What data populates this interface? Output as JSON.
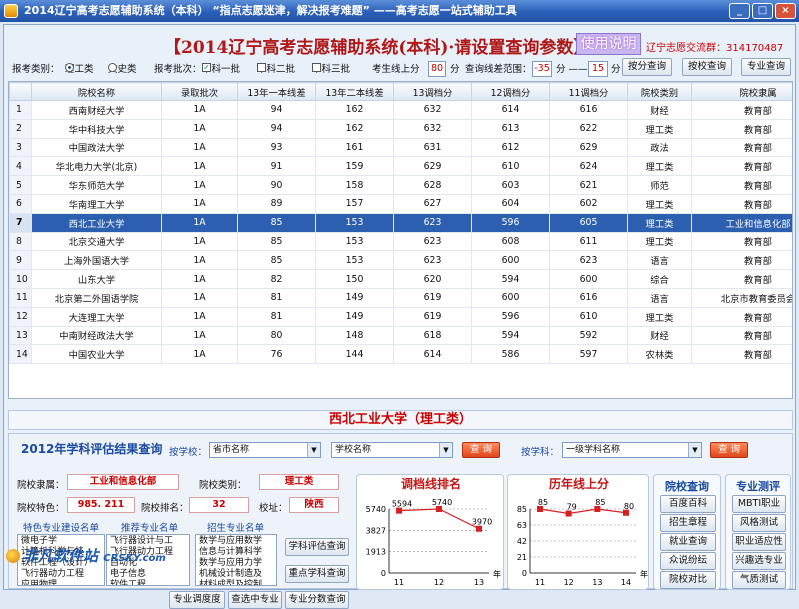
{
  "window": {
    "title": "2014辽宁高考志愿辅助系统（本科） “指点志愿迷津，解决报考难题” ——高考志愿一站式辅助工具",
    "min": "_",
    "max": "□",
    "close": "×"
  },
  "header": {
    "title": "【2014辽宁高考志愿辅助系统(本科)·请设置查询参数】",
    "help": "使用说明",
    "group": "辽宁志愿交流群：314170487"
  },
  "params": {
    "category_label": "报考类别：",
    "category_options": [
      "理工类",
      "文史类"
    ],
    "batch_label": "报考批次：",
    "batch_options": [
      "本科一批",
      "本科二批",
      "本科三批"
    ],
    "score_up_label": "考生线上分",
    "score_up_value": "80",
    "score_unit": "分",
    "range_label": "查询线差范围：",
    "range_min": "-35",
    "range_sep": "分 ——",
    "range_max": "15",
    "range_unit": "分",
    "btn_score": "按分查询",
    "btn_school": "按校查询",
    "btn_major": "专业查询"
  },
  "grid": {
    "columns": [
      "",
      "院校名称",
      "录取批次",
      "13年一本线差",
      "13年二本线差",
      "13调档分",
      "12调档分",
      "11调档分",
      "院校类别",
      "院校隶属"
    ],
    "rows": [
      [
        "1",
        "西南财经大学",
        "1A",
        "94",
        "162",
        "632",
        "614",
        "616",
        "财经",
        "教育部"
      ],
      [
        "2",
        "华中科技大学",
        "1A",
        "94",
        "162",
        "632",
        "613",
        "622",
        "理工类",
        "教育部"
      ],
      [
        "3",
        "中国政法大学",
        "1A",
        "93",
        "161",
        "631",
        "612",
        "629",
        "政法",
        "教育部"
      ],
      [
        "4",
        "华北电力大学(北京)",
        "1A",
        "91",
        "159",
        "629",
        "610",
        "624",
        "理工类",
        "教育部"
      ],
      [
        "5",
        "华东师范大学",
        "1A",
        "90",
        "158",
        "628",
        "603",
        "621",
        "师范",
        "教育部"
      ],
      [
        "6",
        "华南理工大学",
        "1A",
        "89",
        "157",
        "627",
        "604",
        "602",
        "理工类",
        "教育部"
      ],
      [
        "7",
        "西北工业大学",
        "1A",
        "85",
        "153",
        "623",
        "596",
        "605",
        "理工类",
        "工业和信息化部"
      ],
      [
        "8",
        "北京交通大学",
        "1A",
        "85",
        "153",
        "623",
        "608",
        "611",
        "理工类",
        "教育部"
      ],
      [
        "9",
        "上海外国语大学",
        "1A",
        "85",
        "153",
        "623",
        "600",
        "623",
        "语言",
        "教育部"
      ],
      [
        "10",
        "山东大学",
        "1A",
        "82",
        "150",
        "620",
        "594",
        "600",
        "综合",
        "教育部"
      ],
      [
        "11",
        "北京第二外国语学院",
        "1A",
        "81",
        "149",
        "619",
        "600",
        "616",
        "语言",
        "北京市教育委员会"
      ],
      [
        "12",
        "大连理工大学",
        "1A",
        "81",
        "149",
        "619",
        "596",
        "610",
        "理工类",
        "教育部"
      ],
      [
        "13",
        "中南财经政法大学",
        "1A",
        "80",
        "148",
        "618",
        "594",
        "592",
        "财经",
        "教育部"
      ],
      [
        "14",
        "中国农业大学",
        "1A",
        "76",
        "144",
        "614",
        "586",
        "597",
        "农林类",
        "教育部"
      ]
    ],
    "selected": 6
  },
  "selected_school": "西北工业大学（理工类）",
  "eval": {
    "title": "2012年学科评估结果查询",
    "by_school": "按学校：",
    "province_placeholder": "省市名称",
    "school_placeholder": "学校名称",
    "query": "查 询",
    "by_subject": "按学科：",
    "subject_placeholder": "一级学科名称"
  },
  "info": {
    "affil_label": "院校隶属：",
    "affil": "工业和信息化部",
    "type_label": "院校类别：",
    "type": "理工类",
    "feature_label": "院校特色：",
    "feature": "985. 211",
    "rank_label": "院校排名：",
    "rank": "32",
    "loc_label": "校址：",
    "loc": "陕西"
  },
  "lists": {
    "featured_title": "特色专业建设名单",
    "featured": [
      "微电子学",
      "计算机科学与技",
      "软件工程（设计）",
      "飞行器动力工程",
      "应用物理",
      "材料成型"
    ],
    "recommended_title": "推荐专业名单",
    "recommended": [
      "飞行器设计与工",
      "飞行器动力工程",
      "自动化",
      "电子信息",
      "软件工程",
      "航海技术"
    ],
    "admission_title": "招生专业名单",
    "admission": [
      "数学与应用数学",
      "信息与计算科学",
      "数学与应用力学",
      "机械设计制造及",
      "材料成型及控制",
      "计算机科学与技术"
    ]
  },
  "actions": {
    "subject_eval": "学科评估查询",
    "key_subject": "重点学科查询",
    "major_score": "专业分数查询",
    "major_fit": "专业调度度",
    "select_major": "查选中专业"
  },
  "charts": {
    "rank_title": "调档线排名",
    "history_title": "历年线上分",
    "year_suffix": "年",
    "rank_chart": {
      "type": "line",
      "x": [
        "11",
        "12",
        "13"
      ],
      "values": [
        5594,
        5740,
        3970
      ],
      "yticks": [
        "5740",
        "3827",
        "1913",
        "0"
      ],
      "ylim": [
        0,
        5740
      ]
    },
    "history_chart": {
      "type": "line",
      "x": [
        "11",
        "12",
        "13",
        "14"
      ],
      "values": [
        85,
        79,
        85,
        80
      ],
      "yticks": [
        "85",
        "63",
        "42",
        "21",
        "0"
      ],
      "ylim": [
        0,
        85
      ]
    }
  },
  "school_query": {
    "title": "院校查询",
    "items": [
      "百度百科",
      "招生章程",
      "就业查询",
      "众说纷纭",
      "院校对比"
    ]
  },
  "major_test": {
    "title": "专业测评",
    "items": [
      "MBTI职业",
      "风格测试",
      "职业适应性",
      "兴趣选专业",
      "气质测试"
    ]
  },
  "watermark": {
    "text": "非凡软件站",
    "sub": "CRSKY.com"
  }
}
